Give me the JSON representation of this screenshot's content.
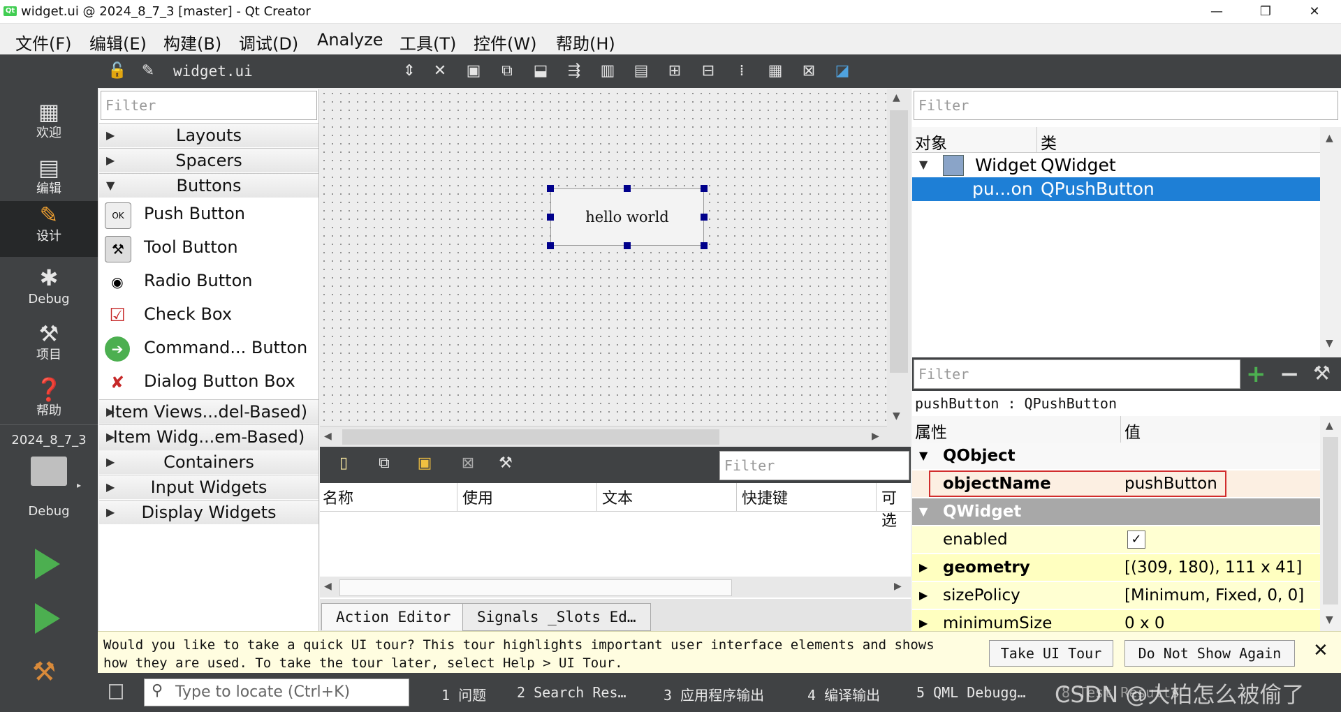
{
  "window": {
    "title": "widget.ui @ 2024_8_7_3 [master] - Qt Creator",
    "minimize": "—",
    "maximize": "❐",
    "close": "✕"
  },
  "menu": [
    "文件(F)",
    "编辑(E)",
    "构建(B)",
    "调试(D)",
    "Analyze",
    "工具(T)",
    "控件(W)",
    "帮助(H)"
  ],
  "modes": [
    {
      "label": "欢迎",
      "icon": "grid-icon"
    },
    {
      "label": "编辑",
      "icon": "document-icon"
    },
    {
      "label": "设计",
      "icon": "pencil-icon"
    },
    {
      "label": "Debug",
      "icon": "bug-icon"
    },
    {
      "label": "项目",
      "icon": "wrench-icon"
    },
    {
      "label": "帮助",
      "icon": "help-icon"
    }
  ],
  "kit": {
    "project": "2024_8_7_3",
    "mode": "Debug"
  },
  "toolbar": {
    "file_name": "widget.ui"
  },
  "widgetbox": {
    "filter_placeholder": "Filter",
    "categories_top": [
      "Layouts",
      "Spacers",
      "Buttons"
    ],
    "buttons": [
      "Push Button",
      "Tool Button",
      "Radio Button",
      "Check Box",
      "Command... Button",
      "Dialog Button Box"
    ],
    "categories_bottom": [
      "Item Views...del-Based)",
      "Item Widg...em-Based)",
      "Containers",
      "Input Widgets",
      "Display Widgets"
    ]
  },
  "form": {
    "button_text": "hello world"
  },
  "action_editor": {
    "filter_placeholder": "Filter",
    "columns": [
      "名称",
      "使用",
      "文本",
      "快捷键",
      "可选"
    ],
    "tabs": [
      "Action Editor",
      "Signals _Slots Ed…"
    ]
  },
  "object_inspector": {
    "filter_placeholder": "Filter",
    "col_object": "对象",
    "col_class": "类",
    "rows": [
      {
        "object": "Widget",
        "class": "QWidget"
      },
      {
        "object": "pu...on",
        "class": "QPushButton"
      }
    ]
  },
  "property_editor": {
    "filter_placeholder": "Filter",
    "context": "pushButton : QPushButton",
    "col_property": "属性",
    "col_value": "值",
    "group_qobject": "QObject",
    "group_qwidget": "QWidget",
    "rows": [
      {
        "name": "objectName",
        "value": "pushButton"
      },
      {
        "name": "enabled",
        "value": "✓"
      },
      {
        "name": "geometry",
        "value": "[(309, 180), 111 x 41]"
      },
      {
        "name": "sizePolicy",
        "value": "[Minimum, Fixed, 0, 0]"
      },
      {
        "name": "minimumSize",
        "value": "0 x 0"
      }
    ]
  },
  "tour": {
    "line1": "Would you like to take a quick UI tour? This tour highlights important user interface elements and shows",
    "line2": "how they are used. To take the tour later, select Help > UI Tour.",
    "take": "Take UI Tour",
    "dismiss": "Do Not Show Again"
  },
  "statusbar": {
    "locate_placeholder": "Type to locate (Ctrl+K)",
    "tabs": [
      "1  问题",
      "2  Search Res…",
      "3  应用程序输出",
      "4  编译输出",
      "5  QML Debugg…",
      "8  Test Results"
    ],
    "watermark": "CSDN @大柏怎么被偷了"
  },
  "colors": {
    "dark": "#404244",
    "selection": "#1e7fd6",
    "highlight": "#d12d2d"
  }
}
